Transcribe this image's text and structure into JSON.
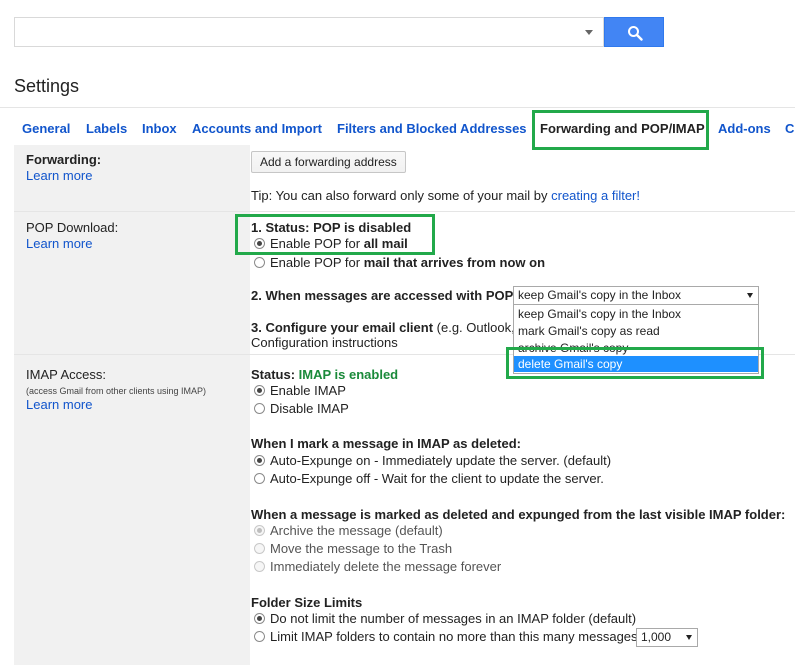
{
  "search": {
    "value": "",
    "placeholder": ""
  },
  "page_title": "Settings",
  "tabs": [
    {
      "label": "General"
    },
    {
      "label": "Labels"
    },
    {
      "label": "Inbox"
    },
    {
      "label": "Accounts and Import"
    },
    {
      "label": "Filters and Blocked Addresses"
    },
    {
      "label": "Forwarding and POP/IMAP"
    },
    {
      "label": "Add-ons"
    },
    {
      "label": "C"
    }
  ],
  "forwarding": {
    "title": "Forwarding:",
    "learn_more": "Learn more",
    "add_button": "Add a forwarding address",
    "tip_prefix": "Tip: You can also forward only some of your mail by ",
    "tip_link": "creating a filter!"
  },
  "pop": {
    "title": "POP Download:",
    "learn_more": "Learn more",
    "status_label": "1. Status: POP is disabled",
    "enable_all_prefix": "Enable POP for ",
    "enable_all_bold": "all mail",
    "enable_new_prefix": "Enable POP for ",
    "enable_new_bold": "mail that arrives from now on",
    "when_accessed": "2. When messages are accessed with POP",
    "select_value": "keep Gmail's copy in the Inbox",
    "options": [
      "keep Gmail's copy in the Inbox",
      "mark Gmail's copy as read",
      "archive Gmail's copy",
      "delete Gmail's copy"
    ],
    "configure_bold": "3. Configure your email client",
    "configure_rest": " (e.g. Outlook,",
    "config_link": "Configuration instructions"
  },
  "imap": {
    "title": "IMAP Access:",
    "subtitle": "(access Gmail from other clients using IMAP)",
    "learn_more": "Learn more",
    "status_prefix": "Status: ",
    "status_value": "IMAP is enabled",
    "enable": "Enable IMAP",
    "disable": "Disable IMAP",
    "deleted_heading": "When I mark a message in IMAP as deleted:",
    "expunge_on": "Auto-Expunge on - Immediately update the server. (default)",
    "expunge_off": "Auto-Expunge off - Wait for the client to update the server.",
    "expunged_heading": "When a message is marked as deleted and expunged from the last visible IMAP folder:",
    "archive": "Archive the message (default)",
    "trash": "Move the message to the Trash",
    "delete_forever": "Immediately delete the message forever",
    "folder_heading": "Folder Size Limits",
    "no_limit": "Do not limit the number of messages in an IMAP folder (default)",
    "limit": "Limit IMAP folders to contain no more than this many messages",
    "limit_value": "1,000"
  },
  "colors": {
    "accent_link": "#1155cc",
    "highlight": "#22a94a",
    "search_button": "#4285f4",
    "enabled_green": "#1a8a3a"
  }
}
